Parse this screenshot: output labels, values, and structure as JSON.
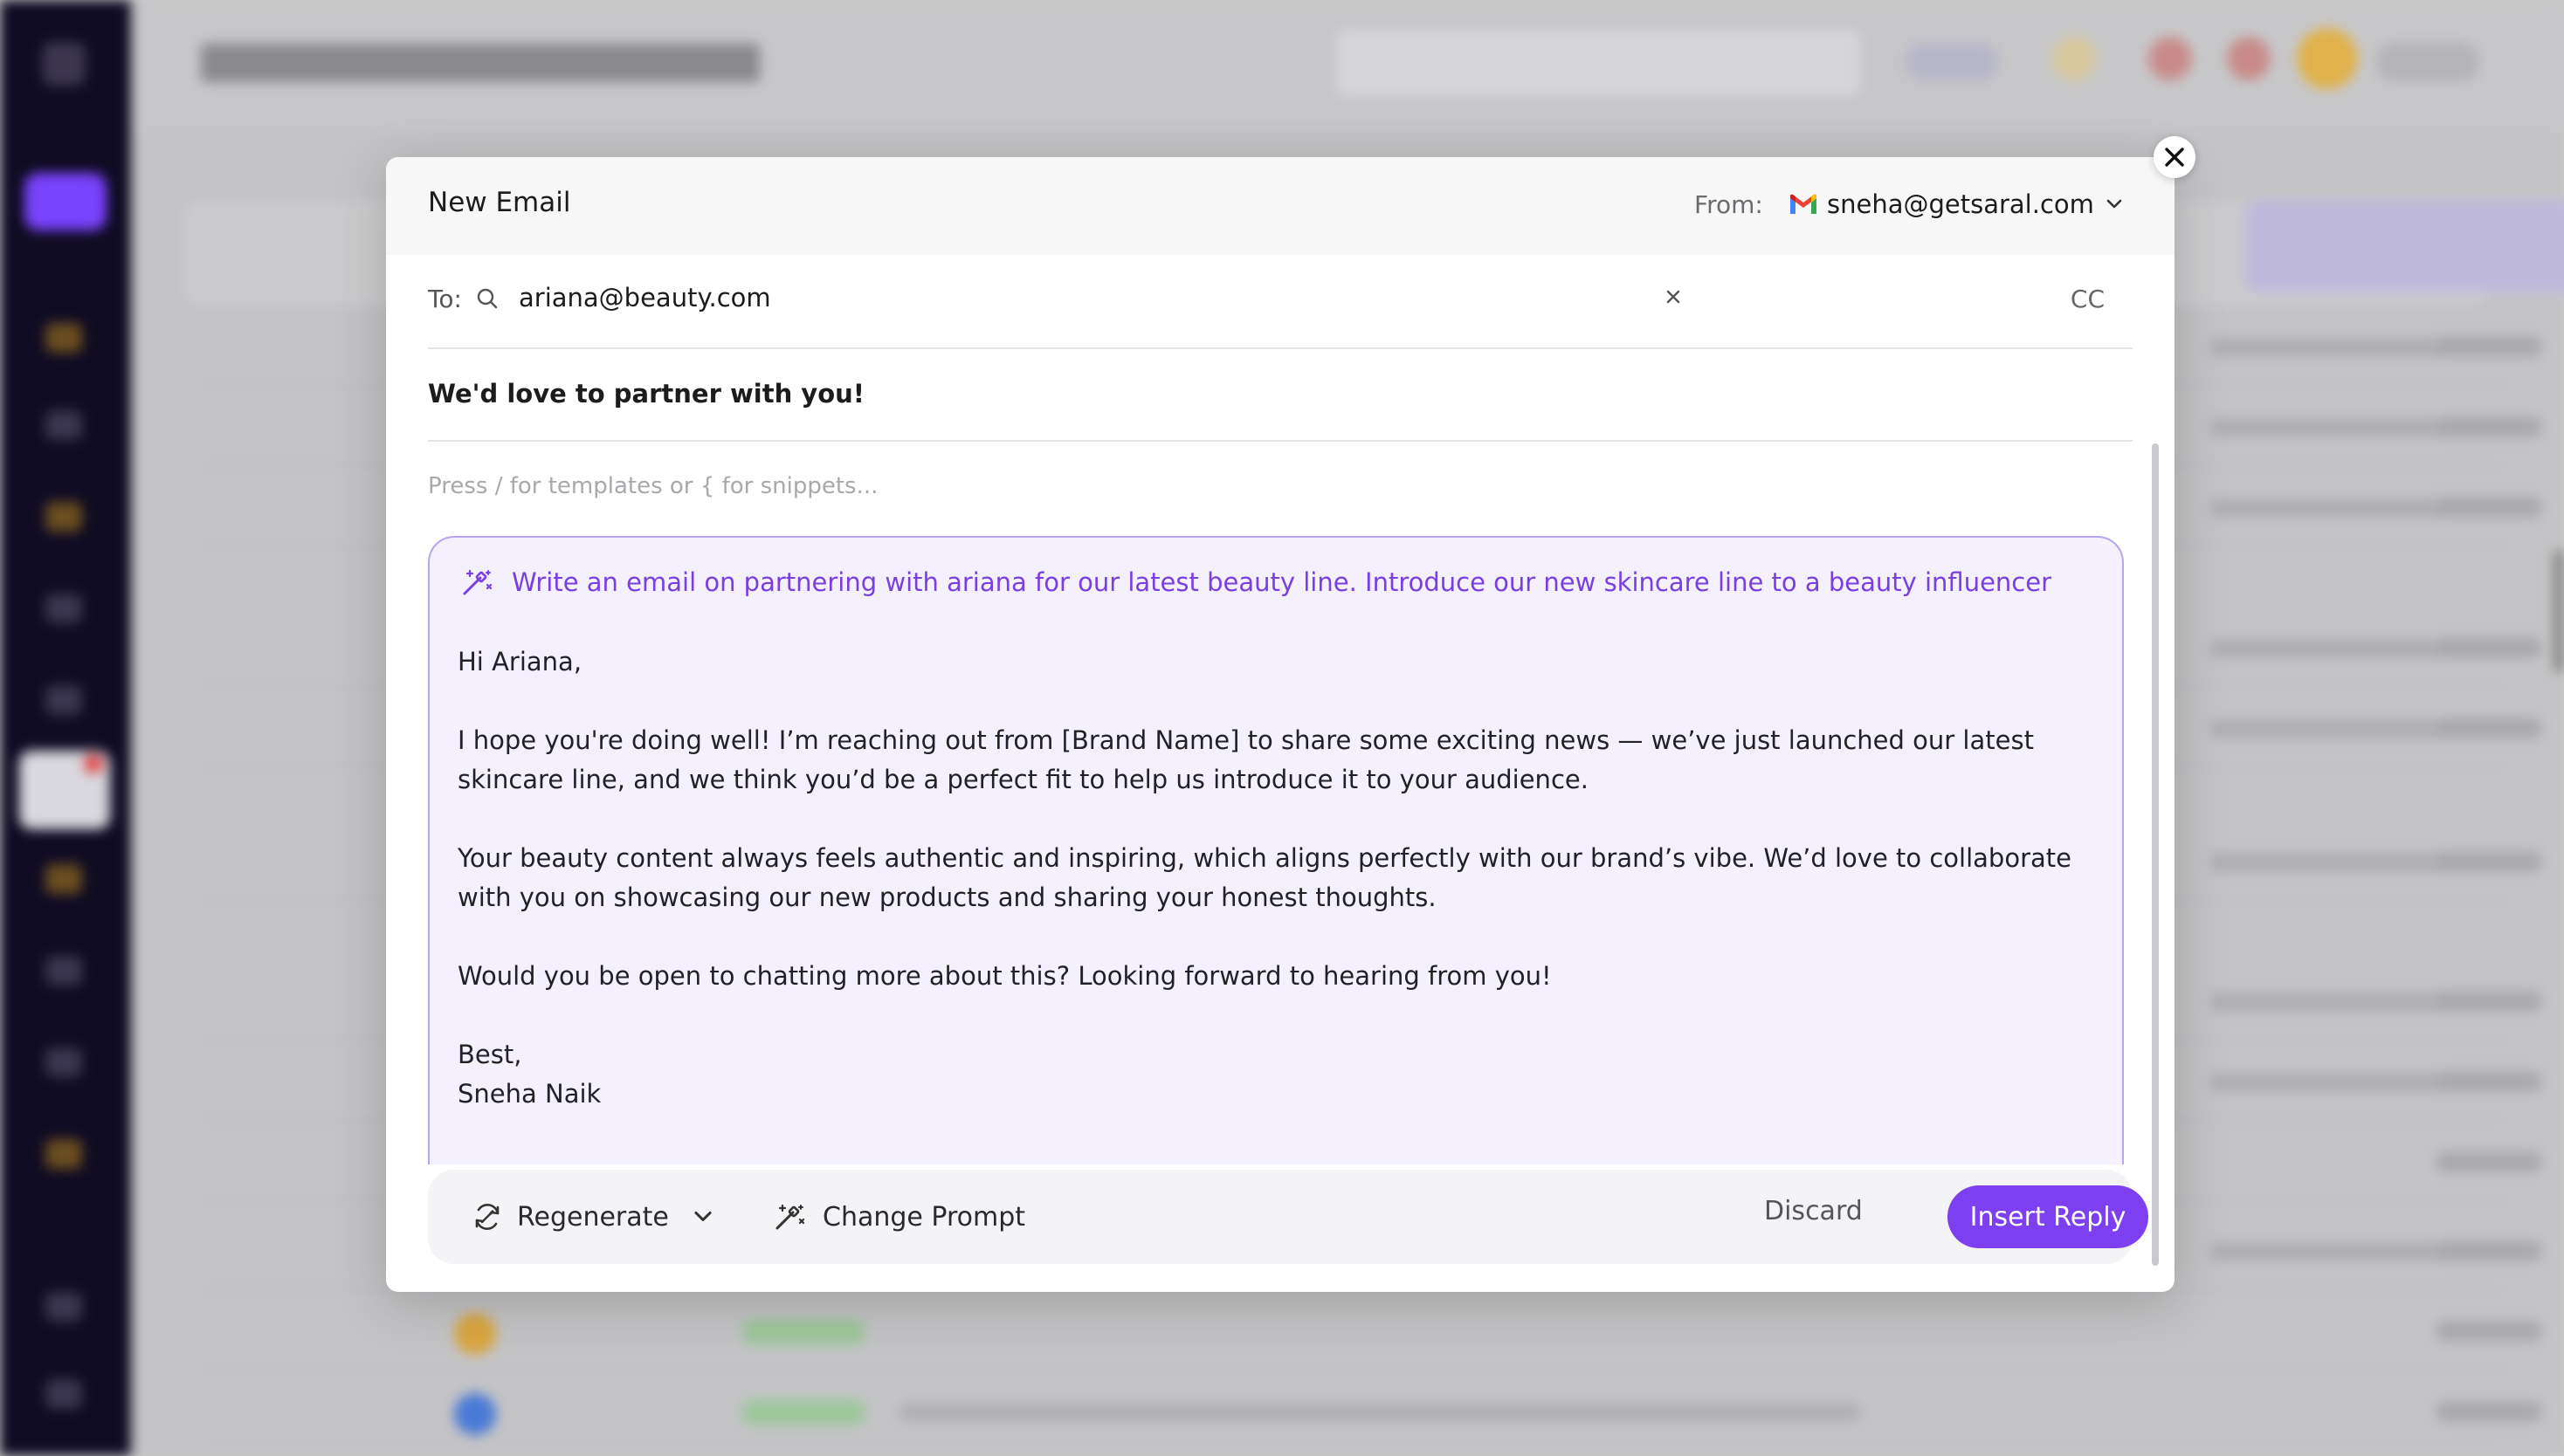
{
  "modal": {
    "title": "New Email",
    "from_label": "From:",
    "from_address": "sneha@getsaral.com",
    "to_label": "To:",
    "to_value": "ariana@beauty.com",
    "cc_label": "CC",
    "subject": "We'd love to partner with you!",
    "snippet_hint": "Press / for templates or { for snippets...",
    "ai_prompt": "Write an email on partnering with ariana for our latest beauty line. Introduce our new skincare line to a beauty influencer",
    "ai_body": {
      "greeting": "Hi Ariana,",
      "paragraph_1": "I hope you're doing well! I’m reaching out from [Brand Name] to share some exciting news — we’ve just launched our latest skincare line, and we think you’d be a perfect fit to help us introduce it to your audience.",
      "paragraph_2": "Your beauty content always feels authentic and inspiring, which aligns perfectly with our brand’s vibe. We’d love to collaborate with you on showcasing our new products and sharing your honest thoughts.",
      "paragraph_3": "Would you be open to chatting more about this? Looking forward to hearing from you!",
      "signoff": "Best,",
      "signature": "Sneha Naik"
    },
    "toolbar": {
      "regenerate_label": "Regenerate",
      "change_prompt_label": "Change Prompt",
      "discard_label": "Discard",
      "insert_label": "Insert Reply"
    }
  },
  "colors": {
    "accent": "#7d3ff0",
    "prompt_text": "#7a3fe0",
    "ai_box_bg": "#f4f0fd",
    "ai_box_border": "#b9a4ee",
    "sidebar_bg": "#0f0b22"
  },
  "icons": {
    "close": "close-icon",
    "gmail": "gmail-icon",
    "chevron": "chevron-down-icon",
    "search": "search-icon",
    "clear": "clear-icon",
    "magic": "magic-wand-icon",
    "regenerate": "regenerate-icon"
  }
}
